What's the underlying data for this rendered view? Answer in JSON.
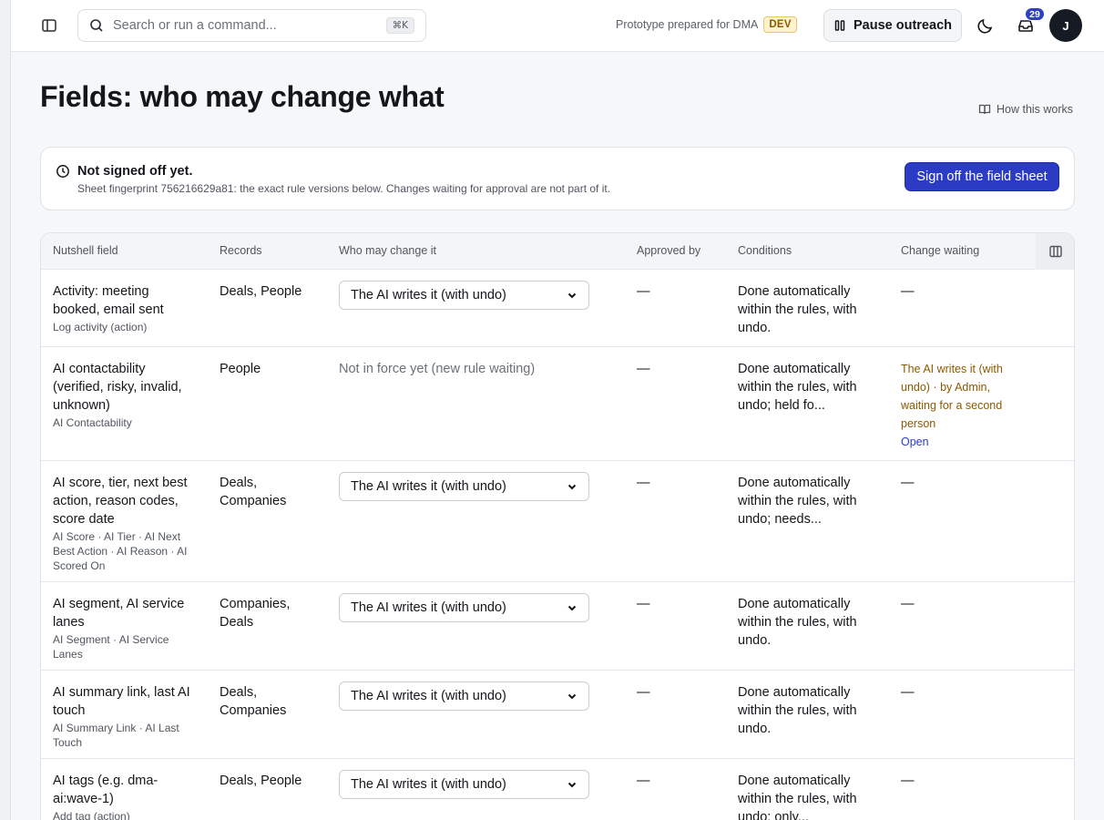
{
  "topbar": {
    "search_placeholder": "Search or run a command...",
    "search_shortcut": "⌘K",
    "prototype_text": "Prototype prepared for DMA",
    "env_badge": "DEV",
    "pause_label": "Pause outreach",
    "inbox_count": "29",
    "avatar_initial": "J",
    "accent_color": "#2b3bc4"
  },
  "page": {
    "title": "Fields: who may change what",
    "how_link": "How this works"
  },
  "signoff": {
    "title": "Not signed off yet.",
    "description": "Sheet fingerprint 756216629a81: the exact rule versions below. Changes waiting for approval are not part of it.",
    "button": "Sign off the field sheet"
  },
  "table": {
    "headers": {
      "field": "Nutshell field",
      "records": "Records",
      "who": "Who may change it",
      "approved": "Approved by",
      "conditions": "Conditions",
      "change": "Change waiting"
    },
    "rows": [
      {
        "field": "Activity: meeting booked, email sent",
        "sub": "Log activity (action)",
        "records": "Deals, People",
        "who": "The AI writes it (with undo)",
        "approved": "—",
        "conditions": "Done automatically within the rules, with undo.",
        "change": "—"
      },
      {
        "field": "AI contactability (verified, risky, invalid, unknown)",
        "sub": "AI Contactability",
        "records": "People",
        "who": "Not in force yet (new rule waiting)",
        "approved": "—",
        "conditions": "Done automatically within the rules, with undo; held fo...",
        "change": "The AI writes it (with undo) · by Admin, waiting for a second person",
        "change_link": "Open"
      },
      {
        "field": "AI score, tier, next best action, reason codes, score date",
        "sub": "AI Score · AI Tier · AI Next Best Action · AI Reason · AI Scored On",
        "records": "Deals, Companies",
        "who": "The AI writes it (with undo)",
        "approved": "—",
        "conditions": "Done automatically within the rules, with undo; needs...",
        "change": "—"
      },
      {
        "field": "AI segment, AI service lanes",
        "sub": "AI Segment · AI Service Lanes",
        "records": "Companies, Deals",
        "who": "The AI writes it (with undo)",
        "approved": "—",
        "conditions": "Done automatically within the rules, with undo.",
        "change": "—"
      },
      {
        "field": "AI summary link, last AI touch",
        "sub": "AI Summary Link · AI Last Touch",
        "records": "Deals, Companies",
        "who": "The AI writes it (with undo)",
        "approved": "—",
        "conditions": "Done automatically within the rules, with undo.",
        "change": "—"
      },
      {
        "field": "AI tags (e.g. dma-ai:wave-1)",
        "sub": "Add tag (action)",
        "records": "Deals, People",
        "who": "The AI writes it (with undo)",
        "approved": "—",
        "conditions": "Done automatically within the rules, with undo; only...",
        "change": "—"
      }
    ]
  }
}
